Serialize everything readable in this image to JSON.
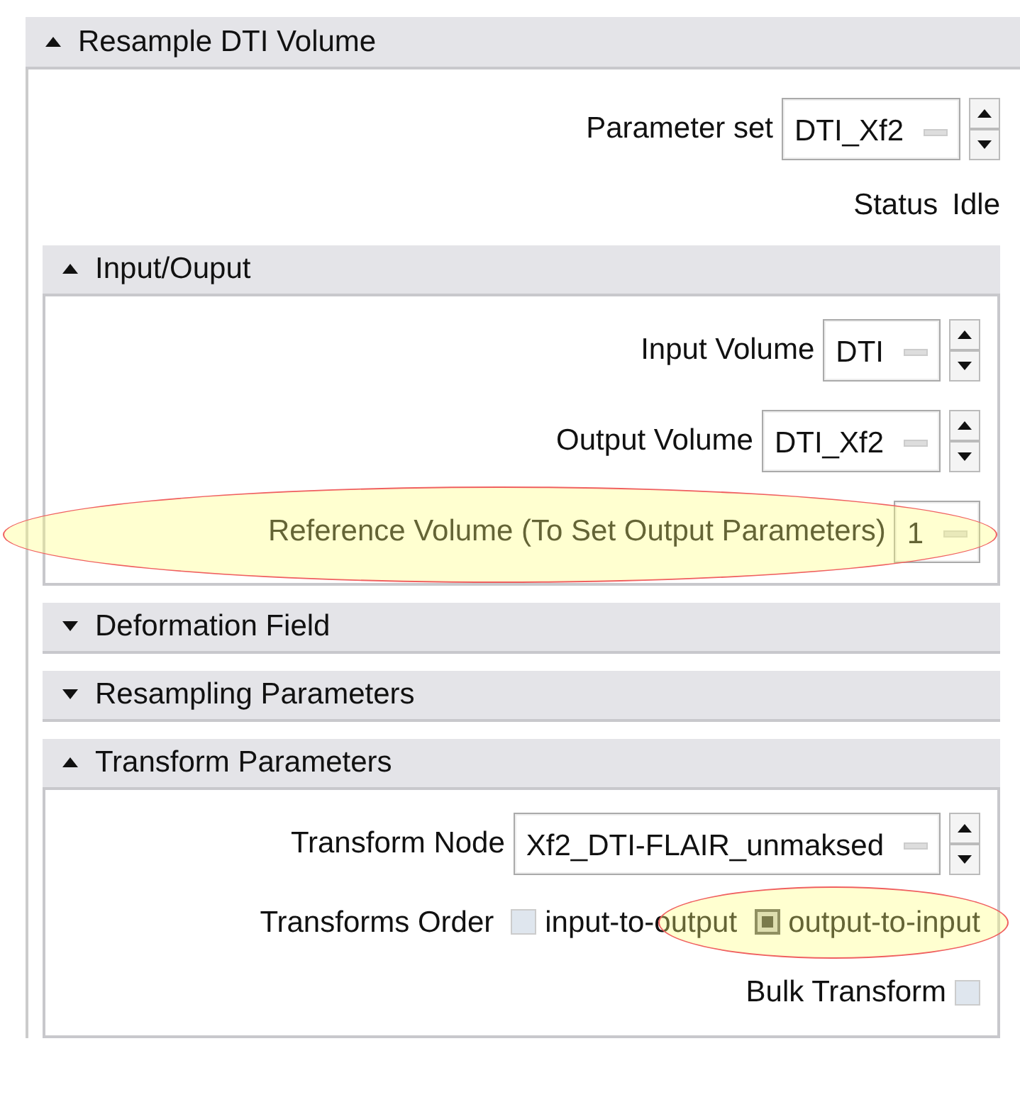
{
  "panel": {
    "title": "Resample DTI Volume",
    "expanded": true,
    "parameter_set": {
      "label": "Parameter set",
      "value": "DTI_Xf2"
    },
    "status": {
      "label": "Status",
      "value": "Idle"
    },
    "sections": [
      {
        "title": "Input/Ouput",
        "expanded": true,
        "rows": [
          {
            "kind": "combo",
            "label": "Input Volume",
            "value": "DTI",
            "spinner": true,
            "highlighted": false
          },
          {
            "kind": "combo",
            "label": "Output Volume",
            "value": "DTI_Xf2",
            "spinner": true,
            "highlighted": false
          },
          {
            "kind": "combo",
            "label": "Reference Volume (To Set Output Parameters)",
            "value": "1",
            "spinner": false,
            "highlighted": true
          }
        ]
      },
      {
        "title": "Deformation Field",
        "expanded": false
      },
      {
        "title": "Resampling Parameters",
        "expanded": false
      },
      {
        "title": "Transform Parameters",
        "expanded": true,
        "rows": [
          {
            "kind": "combo",
            "label": "Transform Node",
            "value": "Xf2_DTI-FLAIR_unmaksed",
            "spinner": true,
            "highlighted": false
          },
          {
            "kind": "radio",
            "label": "Transforms Order",
            "options": [
              {
                "label": "input-to-output",
                "selected": false,
                "highlighted": false
              },
              {
                "label": "output-to-input",
                "selected": true,
                "highlighted": true
              }
            ]
          },
          {
            "kind": "check",
            "label": "Bulk Transform",
            "checked": false
          }
        ]
      }
    ]
  }
}
